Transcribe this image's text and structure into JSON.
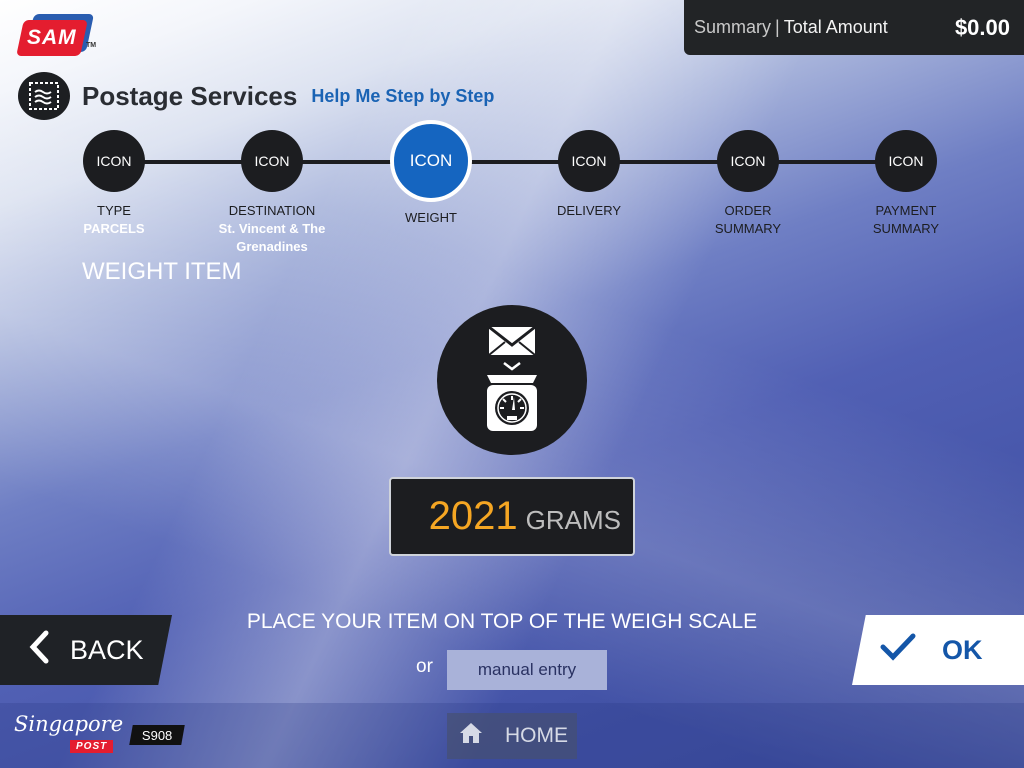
{
  "brand": {
    "logo_text": "SAM",
    "tm": "TM"
  },
  "summary": {
    "label": "Summary",
    "separator": "|",
    "total_label": "Total Amount",
    "amount": "$0.00"
  },
  "header": {
    "title": "Postage Services",
    "help_link": "Help Me Step by Step",
    "icon": "stamp-icon"
  },
  "steps": [
    {
      "icon": "ICON",
      "label": "TYPE",
      "sub": "PARCELS",
      "active": false
    },
    {
      "icon": "ICON",
      "label": "DESTINATION",
      "sub": "St. Vincent & The Grenadines",
      "active": false
    },
    {
      "icon": "ICON",
      "label": "WEIGHT",
      "sub": "",
      "active": true
    },
    {
      "icon": "ICON",
      "label": "DELIVERY",
      "sub": "",
      "active": false
    },
    {
      "icon": "ICON",
      "label": "ORDER",
      "label2": "SUMMARY",
      "sub": "",
      "active": false
    },
    {
      "icon": "ICON",
      "label": "PAYMENT",
      "label2": "SUMMARY",
      "sub": "",
      "active": false
    }
  ],
  "main": {
    "heading": "WEIGHT ITEM",
    "weight_value": "2021",
    "weight_unit": "GRAMS",
    "instruction": "PLACE YOUR ITEM ON TOP OF THE WEIGH SCALE",
    "or": "or",
    "manual_entry": "manual entry"
  },
  "nav": {
    "back": "BACK",
    "ok": "OK",
    "home": "HOME"
  },
  "footer": {
    "sp_script": "Singapore",
    "sp_post": "POST",
    "kiosk_id": "S908"
  },
  "colors": {
    "accent": "#1565c0",
    "weight": "#f5a623",
    "brand_red": "#e41d2f"
  }
}
